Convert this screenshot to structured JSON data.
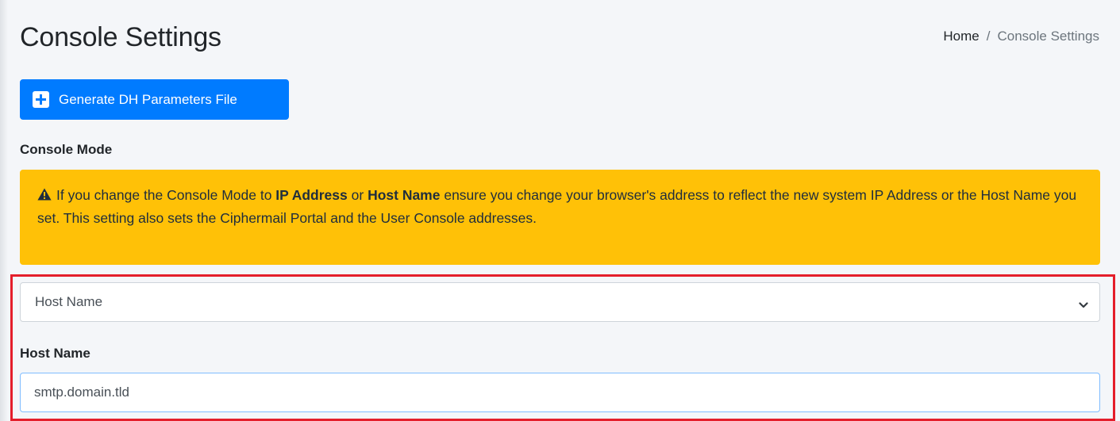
{
  "page": {
    "title": "Console Settings"
  },
  "breadcrumb": {
    "home": "Home",
    "separator": "/",
    "current": "Console Settings"
  },
  "actions": {
    "generate_dh_label": "Generate DH Parameters File",
    "generate_dh_icon": "plus-square-icon"
  },
  "console_mode": {
    "label": "Console Mode",
    "alert": {
      "icon": "warning-triangle-icon",
      "text_1": "If you change the Console Mode to ",
      "bold_1": "IP Address",
      "text_2": " or ",
      "bold_2": "Host Name",
      "text_3": " ensure you change your browser's address to reflect the new system IP Address or the Host Name you set. This setting also sets the Ciphermail Portal and the User Console addresses."
    },
    "select_value": "Host Name",
    "select_icon": "chevron-down-icon"
  },
  "host_name": {
    "label": "Host Name",
    "value": "smtp.domain.tld"
  },
  "colors": {
    "primary": "#007bff",
    "warning": "#ffc107",
    "highlight": "#e41e2b",
    "background": "#f4f6f9"
  }
}
